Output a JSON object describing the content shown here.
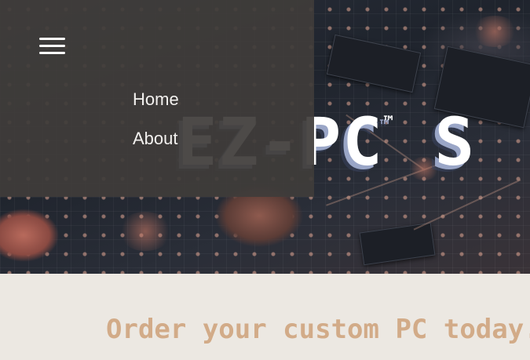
{
  "hero": {
    "brand_text": "EZ-PC",
    "brand_mark": "™",
    "brand_trailing": "S"
  },
  "menu": {
    "toggle_icon": "hamburger-menu-icon",
    "items": [
      {
        "label": "Home"
      },
      {
        "label": "About"
      }
    ]
  },
  "tagline": "Order your custom PC today.",
  "colors": {
    "menu_panel": "#403c3a",
    "tagline": "#d2ab88",
    "band_background": "#ece8e2",
    "brand_shadow": "#9aa6c7"
  }
}
